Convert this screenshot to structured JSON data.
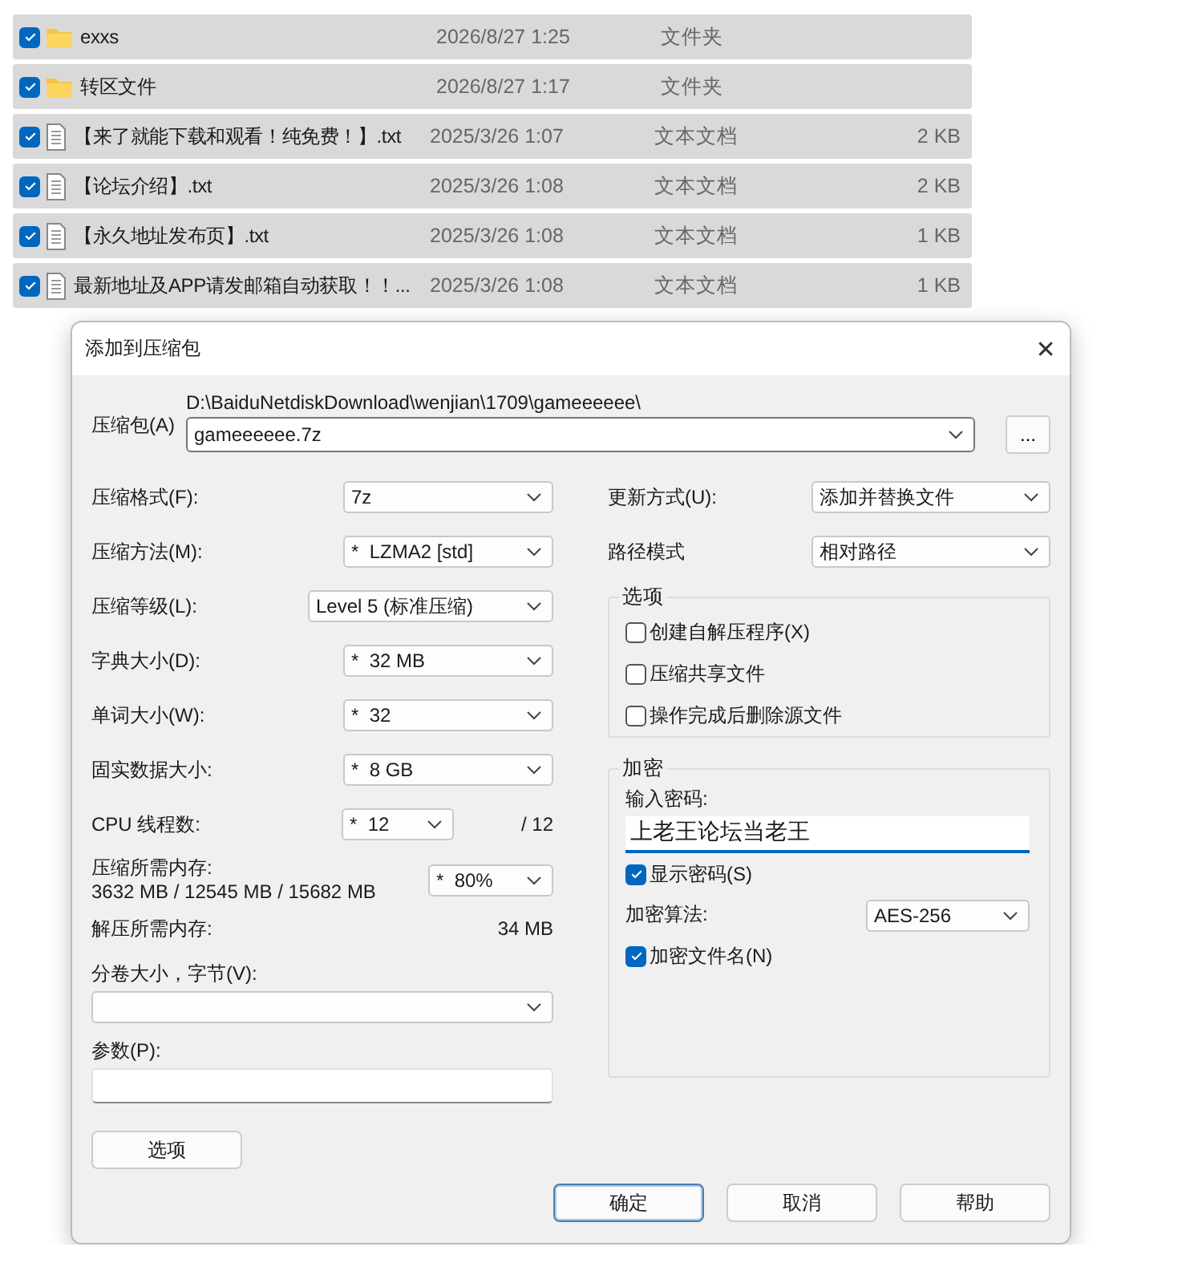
{
  "files": [
    {
      "kind": "folder",
      "checked": true,
      "name": "exxs",
      "date": "2026/8/27 1:25",
      "type": "文件夹"
    },
    {
      "kind": "folder",
      "checked": true,
      "name": "转区文件",
      "date": "2026/8/27 1:17",
      "type": "文件夹"
    },
    {
      "kind": "text",
      "checked": true,
      "name": "【来了就能下载和观看！纯免费！】.txt",
      "date": "2025/3/26 1:07",
      "type": "文本文档",
      "size": "2 KB"
    },
    {
      "kind": "text",
      "checked": true,
      "name": "【论坛介绍】.txt",
      "date": "2025/3/26 1:08",
      "type": "文本文档",
      "size": "2 KB"
    },
    {
      "kind": "text",
      "checked": true,
      "name": "【永久地址发布页】.txt",
      "date": "2025/3/26 1:08",
      "type": "文本文档",
      "size": "1 KB"
    },
    {
      "kind": "text",
      "checked": true,
      "name": "最新地址及APP请发邮箱自动获取！！...",
      "date": "2025/3/26 1:08",
      "type": "文本文档",
      "size": "1 KB"
    }
  ],
  "dialog": {
    "title": "添加到压缩包",
    "close": "✕",
    "archive": {
      "label": "压缩包(A)",
      "path": "D:\\BaiduNetdiskDownload\\wenjian\\1709\\gameeeeee\\",
      "value": "gameeeeee.7z",
      "browse": "..."
    },
    "left_rows": [
      {
        "kind": "combo",
        "label": "压缩格式(F):",
        "value": "7z"
      },
      {
        "kind": "combo",
        "label": "压缩方法(M):",
        "value": "*  LZMA2 [std]"
      },
      {
        "kind": "combo",
        "label": "压缩等级(L):",
        "value": "Level 5 (标准压缩)"
      },
      {
        "kind": "combo",
        "label": "字典大小(D):",
        "value": "*  32 MB"
      },
      {
        "kind": "combo",
        "label": "单词大小(W):",
        "value": "*  32"
      },
      {
        "kind": "combo",
        "label": "固实数据大小:",
        "value": "*  8 GB"
      },
      {
        "kind": "combo",
        "label": "CPU 线程数:",
        "value": "*  12",
        "suffix": "/ 12"
      },
      {
        "kind": "memory",
        "label": "压缩所需内存:",
        "detail": "3632 MB / 12545 MB / 15682 MB",
        "value": "*  80%"
      },
      {
        "kind": "reading",
        "label": "解压所需内存:",
        "value": "34 MB"
      }
    ],
    "volume": {
      "label": "分卷大小，字节(V):"
    },
    "params": {
      "label": "参数(P):"
    },
    "options_button": "选项",
    "update": {
      "label": "更新方式(U):",
      "value": "添加并替换文件"
    },
    "path_mode": {
      "label": "路径模式",
      "value": "相对路径"
    },
    "options": {
      "title": "选项",
      "items": [
        {
          "label": "创建自解压程序(X)",
          "checked": false
        },
        {
          "label": "压缩共享文件",
          "checked": false
        },
        {
          "label": "操作完成后删除源文件",
          "checked": false
        }
      ]
    },
    "encryption": {
      "title": "加密",
      "password_label": "输入密码:",
      "password": "上老王论坛当老王",
      "show_password": {
        "label": "显示密码(S)",
        "checked": true
      },
      "method": {
        "label": "加密算法:",
        "value": "AES-256"
      },
      "encrypt_names": {
        "label": "加密文件名(N)",
        "checked": true
      }
    },
    "buttons": [
      {
        "label": "确定",
        "default": true
      },
      {
        "label": "取消",
        "default": false
      },
      {
        "label": "帮助",
        "default": false
      }
    ]
  }
}
